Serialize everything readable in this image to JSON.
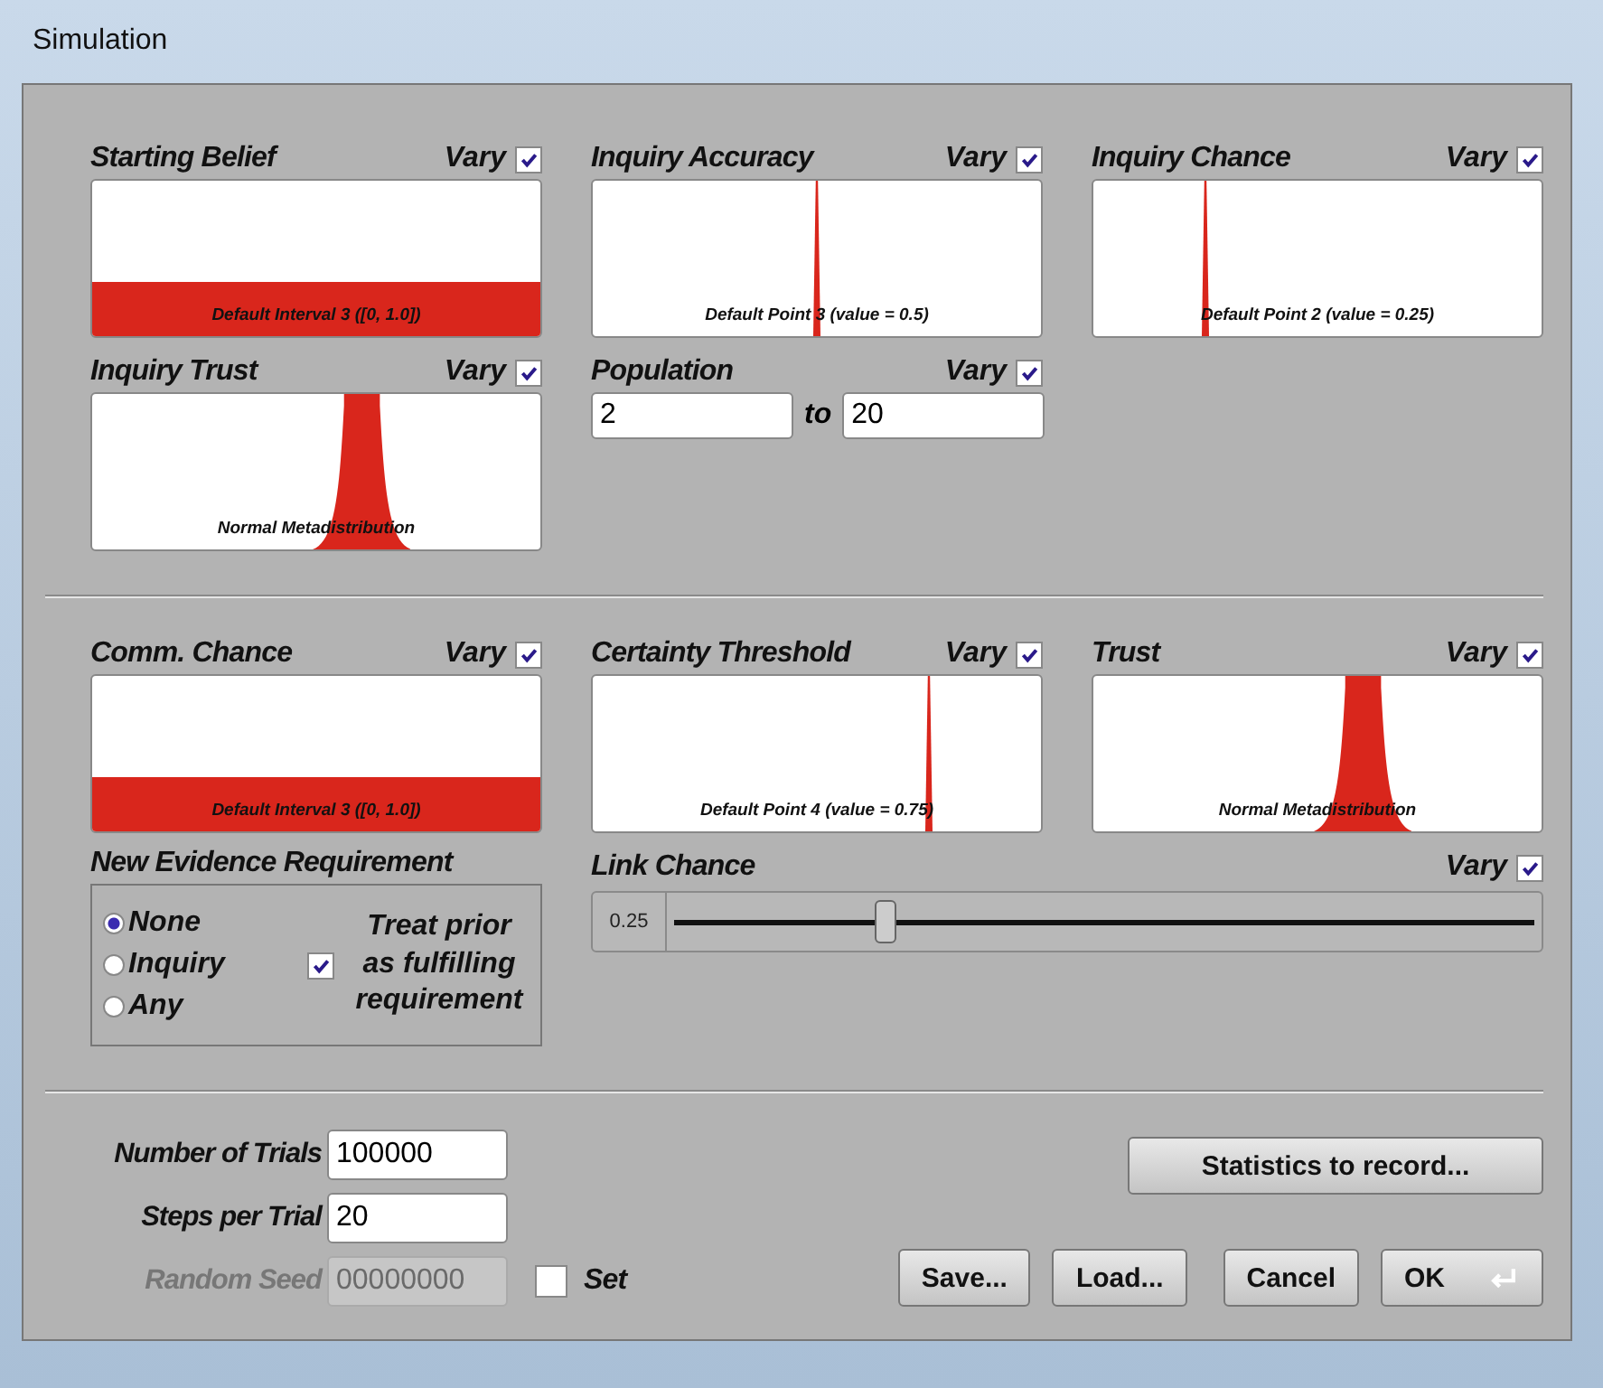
{
  "window": {
    "title": "Simulation"
  },
  "top_parameters": [
    {
      "label": "Starting Belief",
      "vary_label": "Vary",
      "vary": true,
      "kind": "interval",
      "caption": "Default Interval 3 ([0, 1.0])"
    },
    {
      "label": "Inquiry Accuracy",
      "vary_label": "Vary",
      "vary": true,
      "kind": "point",
      "level": 0.5,
      "caption": "Default Point 3 (value = 0.5)"
    },
    {
      "label": "Inquiry Chance",
      "vary_label": "Vary",
      "vary": true,
      "kind": "point",
      "level": 0.25,
      "caption": "Default Point 2 (value = 0.25)"
    },
    {
      "label": "Inquiry Trust",
      "vary_label": "Vary",
      "vary": true,
      "kind": "normal",
      "caption": "Normal Metadistribution"
    }
  ],
  "population": {
    "label": "Population",
    "vary_label": "Vary",
    "vary": true,
    "from": "2",
    "to_label": "to",
    "to": "20"
  },
  "bottom_parameters": [
    {
      "label": "Comm. Chance",
      "vary_label": "Vary",
      "vary": true,
      "kind": "interval",
      "caption": "Default Interval 3 ([0, 1.0])"
    },
    {
      "label": "Certainty Threshold",
      "vary_label": "Vary",
      "vary": true,
      "kind": "point",
      "level": 0.75,
      "caption": "Default Point 4 (value = 0.75)"
    },
    {
      "label": "Trust",
      "vary_label": "Vary",
      "vary": true,
      "kind": "normal",
      "caption": "Normal Metadistribution"
    }
  ],
  "evidence": {
    "title": "New Evidence Requirement",
    "options": [
      {
        "label": "None",
        "selected": true
      },
      {
        "label": "Inquiry",
        "selected": false
      },
      {
        "label": "Any",
        "selected": false
      }
    ],
    "treat_prior": {
      "label": "Treat prior as fulfilling requirement",
      "checked": true
    }
  },
  "link_chance": {
    "label": "Link Chance",
    "vary_label": "Vary",
    "vary": true,
    "reading": "0.25",
    "level": 0.25
  },
  "fields": [
    {
      "label": "Number of Trials",
      "value": "100000",
      "disabled": false
    },
    {
      "label": "Steps per Trial",
      "value": "20",
      "disabled": false
    },
    {
      "label": "Random Seed",
      "value": "00000000",
      "disabled": true
    }
  ],
  "seed_set": {
    "label": "Set",
    "checked": false
  },
  "statistics_button": "Statistics to record...",
  "buttons": [
    {
      "label": "Save...",
      "kind": "plain"
    },
    {
      "label": "Load...",
      "kind": "plain"
    },
    {
      "label": "Cancel",
      "kind": "plain"
    },
    {
      "label": "OK",
      "kind": "default"
    }
  ]
}
